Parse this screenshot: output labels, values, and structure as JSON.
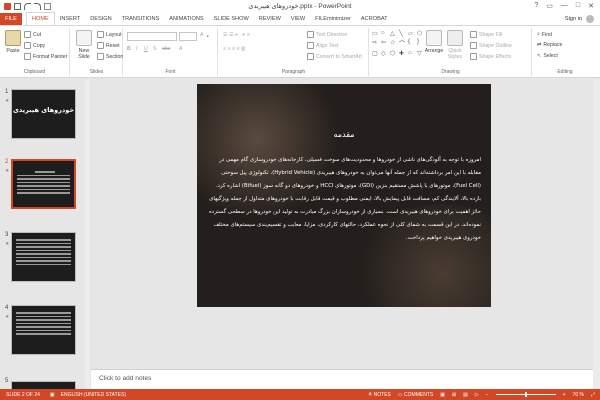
{
  "app": {
    "title": "خودروهای هیبریدی.pptx - PowerPoint",
    "help": "?",
    "sign_in": "Sign in",
    "colors": {
      "accent": "#d24726",
      "ribbon_bg": "#ffffff",
      "slide_bg": "#241f1c"
    }
  },
  "tabs": [
    "FILE",
    "HOME",
    "INSERT",
    "DESIGN",
    "TRANSITIONS",
    "ANIMATIONS",
    "SLIDE SHOW",
    "REVIEW",
    "VIEW",
    "FILEminimizer",
    "ACROBAT"
  ],
  "active_tab": "HOME",
  "ribbon": {
    "clipboard": {
      "paste": "Paste",
      "cut": "Cut",
      "copy": "Copy",
      "format_painter": "Format Painter",
      "label": "Clipboard"
    },
    "slides": {
      "new_slide": "New Slide",
      "layout": "Layout",
      "reset": "Reset",
      "section": "Section",
      "label": "Slides"
    },
    "font": {
      "label": "Font"
    },
    "paragraph": {
      "text_direction": "Text Direction",
      "align_text": "Align Text",
      "convert_smartart": "Convert to SmartArt",
      "label": "Paragraph"
    },
    "drawing": {
      "arrange": "Arrange",
      "quick_styles": "Quick Styles",
      "shape_fill": "Shape Fill",
      "shape_outline": "Shape Outline",
      "shape_effects": "Shape Effects",
      "label": "Drawing"
    },
    "editing": {
      "find": "Find",
      "replace": "Replace",
      "select": "Select",
      "label": "Editing"
    }
  },
  "thumbnails": [
    {
      "number": "1",
      "title": "خودروهای هیبریدی"
    },
    {
      "number": "2"
    },
    {
      "number": "3"
    },
    {
      "number": "4"
    },
    {
      "number": "5"
    }
  ],
  "slide": {
    "title": "مقدمه",
    "paragraphs": [
      "امروزه با توجه به آلودگی‌های ناشی از خودروها و محدودیت‌های سوخت فسیلی، کارخانه‌های خودروسازی گام مهمی در مقابله با این امر برداشته‌اند که از جمله آنها می‌توان به خودروهای هیبریدی (Hybrid Vehicle)، تکنولوژی پیل سوختی (Fuel Cell)، موتورهای با پاشش مستقیم بنزین (GDI)، موتورهای HCCI و خودروهای دو گانه سوز (Bifuel) اشاره کرد.",
      "بازده بالا، آلایندگی کم، مسافت قابل پیمایش بالا، ایمنی مطلوب و قیمت قابل رقابت با خودروهای متداول از جمله ویژگیهای حائز اهمیت برای خودروهای هیبریدی است. بسیاری از خودروسازان بزرگ مبادرت به تولید این خودروها در سطحی گسترده نموده‌اند. در این قسمت به شمای کلی از نحوه عملکرد، حالتهای کارکردی، مزایا، معایب و تقسیم‌بندی سیستم‌های مختلف خودروی هیبریدی خواهیم پرداخت."
    ]
  },
  "notes": {
    "placeholder": "Click to add notes"
  },
  "status": {
    "slide_of": "SLIDE 2 OF 24",
    "language": "ENGLISH (UNITED STATES)",
    "notes": "NOTES",
    "comments": "COMMENTS",
    "zoom": "70 %",
    "zoom_level": 0.5
  }
}
